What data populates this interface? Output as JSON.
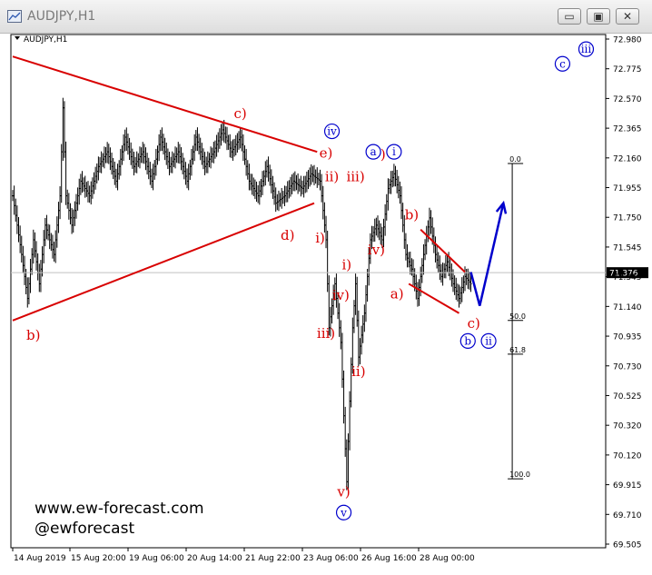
{
  "window": {
    "title": "AUDJPY,H1",
    "minimize_label": "▭",
    "restore_label": "▣",
    "close_label": "✕"
  },
  "chart_data": {
    "type": "line",
    "symbol_label": "AUDJPY,H1",
    "title": "",
    "xlabel": "",
    "ylabel": "",
    "ylim": [
      69.5,
      73.0
    ],
    "grid": false,
    "legend": "none",
    "current_price": 71.376,
    "current_price_label": "71.376",
    "y_ticks": [
      "72.980",
      "72.775",
      "72.570",
      "72.365",
      "72.160",
      "71.955",
      "71.750",
      "71.545",
      "71.345",
      "71.140",
      "70.935",
      "70.730",
      "70.525",
      "70.320",
      "70.120",
      "69.915",
      "69.710",
      "69.505"
    ],
    "x_ticks": [
      "14 Aug 2019",
      "15 Aug 20:00",
      "19 Aug 06:00",
      "20 Aug 14:00",
      "21 Aug 22:00",
      "23 Aug 06:00",
      "26 Aug 16:00",
      "28 Aug 00:00"
    ],
    "price_path": [
      [
        0,
        71.9
      ],
      [
        3,
        71.5
      ],
      [
        5,
        71.2
      ],
      [
        7,
        71.6
      ],
      [
        9,
        71.3
      ],
      [
        11,
        71.7
      ],
      [
        14,
        71.5
      ],
      [
        16,
        71.9
      ],
      [
        17,
        72.5
      ],
      [
        18,
        71.9
      ],
      [
        20,
        71.7
      ],
      [
        23,
        72.0
      ],
      [
        26,
        71.9
      ],
      [
        29,
        72.1
      ],
      [
        32,
        72.2
      ],
      [
        35,
        72.0
      ],
      [
        38,
        72.3
      ],
      [
        41,
        72.1
      ],
      [
        44,
        72.2
      ],
      [
        47,
        72.0
      ],
      [
        50,
        72.3
      ],
      [
        53,
        72.1
      ],
      [
        56,
        72.2
      ],
      [
        59,
        72.0
      ],
      [
        62,
        72.3
      ],
      [
        65,
        72.1
      ],
      [
        68,
        72.2
      ],
      [
        71,
        72.35
      ],
      [
        74,
        72.2
      ],
      [
        77,
        72.3
      ],
      [
        80,
        72.0
      ],
      [
        83,
        71.9
      ],
      [
        86,
        72.1
      ],
      [
        89,
        71.85
      ],
      [
        92,
        71.9
      ],
      [
        95,
        72.0
      ],
      [
        98,
        71.95
      ],
      [
        101,
        72.05
      ],
      [
        104,
        72.0
      ],
      [
        106,
        71.6
      ],
      [
        107,
        71.0
      ],
      [
        109,
        71.3
      ],
      [
        111,
        70.9
      ],
      [
        112,
        70.4
      ],
      [
        113,
        69.95
      ],
      [
        114,
        70.5
      ],
      [
        115,
        71.0
      ],
      [
        116,
        71.3
      ],
      [
        117,
        70.8
      ],
      [
        119,
        71.1
      ],
      [
        121,
        71.6
      ],
      [
        123,
        71.7
      ],
      [
        125,
        71.6
      ],
      [
        127,
        71.95
      ],
      [
        129,
        72.05
      ],
      [
        131,
        71.9
      ],
      [
        133,
        71.5
      ],
      [
        135,
        71.4
      ],
      [
        137,
        71.2
      ],
      [
        139,
        71.5
      ],
      [
        141,
        71.75
      ],
      [
        143,
        71.5
      ],
      [
        145,
        71.35
      ],
      [
        147,
        71.45
      ],
      [
        149,
        71.3
      ],
      [
        151,
        71.2
      ],
      [
        153,
        71.35
      ],
      [
        155,
        71.3
      ]
    ],
    "projection": [
      [
        155,
        71.38
      ],
      [
        158,
        71.15
      ],
      [
        166,
        71.85
      ]
    ],
    "fib_levels": [
      {
        "label": "0.0",
        "value": 72.12
      },
      {
        "label": "50.0",
        "value": 71.05
      },
      {
        "label": "61.8",
        "value": 70.82
      },
      {
        "label": "100.0",
        "value": 69.97
      }
    ],
    "trendlines": [
      {
        "from": [
          0,
          72.85
        ],
        "to": [
          103,
          72.2
        ]
      },
      {
        "from": [
          0,
          71.05
        ],
        "to": [
          102,
          71.85
        ]
      },
      {
        "from": [
          138,
          71.67
        ],
        "to": [
          153,
          71.38
        ]
      },
      {
        "from": [
          134,
          71.3
        ],
        "to": [
          151,
          71.1
        ]
      }
    ],
    "annotations": [
      {
        "text": "c)",
        "x": 77,
        "y": 72.43,
        "color": "red"
      },
      {
        "text": "e)",
        "x": 106,
        "y": 72.16,
        "color": "red"
      },
      {
        "text": "d)",
        "x": 93,
        "y": 71.6,
        "color": "red"
      },
      {
        "text": "b)",
        "x": 7,
        "y": 70.92,
        "color": "red"
      },
      {
        "text": "ii)",
        "x": 108,
        "y": 72.0,
        "color": "red"
      },
      {
        "text": "i)",
        "x": 104,
        "y": 71.58,
        "color": "red"
      },
      {
        "text": "iii)",
        "x": 106,
        "y": 70.93,
        "color": "red"
      },
      {
        "text": "iv)",
        "x": 111,
        "y": 71.19,
        "color": "red"
      },
      {
        "text": "iii)",
        "x": 116,
        "y": 72.0,
        "color": "red"
      },
      {
        "text": "v)",
        "x": 124,
        "y": 72.15,
        "color": "red"
      },
      {
        "text": "i)",
        "x": 113,
        "y": 71.4,
        "color": "red"
      },
      {
        "text": "iv)",
        "x": 123,
        "y": 71.5,
        "color": "red"
      },
      {
        "text": "ii)",
        "x": 117,
        "y": 70.67,
        "color": "red"
      },
      {
        "text": "v)",
        "x": 112,
        "y": 69.85,
        "color": "red"
      },
      {
        "text": "b)",
        "x": 135,
        "y": 71.74,
        "color": "red"
      },
      {
        "text": "a)",
        "x": 130,
        "y": 71.2,
        "color": "red"
      },
      {
        "text": "c)",
        "x": 156,
        "y": 71.0,
        "color": "red"
      }
    ],
    "circle_labels": [
      {
        "text": "iv",
        "x": 108,
        "y": 72.34
      },
      {
        "text": "a",
        "x": 122,
        "y": 72.2
      },
      {
        "text": "i",
        "x": 129,
        "y": 72.2
      },
      {
        "text": "c",
        "x": 186,
        "y": 72.8
      },
      {
        "text": "iii",
        "x": 194,
        "y": 72.9
      },
      {
        "text": "b",
        "x": 154,
        "y": 70.91
      },
      {
        "text": "ii",
        "x": 161,
        "y": 70.91
      },
      {
        "text": "v",
        "x": 112,
        "y": 69.74
      }
    ]
  },
  "watermark": {
    "line1": "www.ew-forecast.com",
    "line2": "@ewforecast"
  },
  "colors": {
    "candle": "#000000",
    "wave_red": "#d80000",
    "wave_blue": "#0000cc"
  }
}
